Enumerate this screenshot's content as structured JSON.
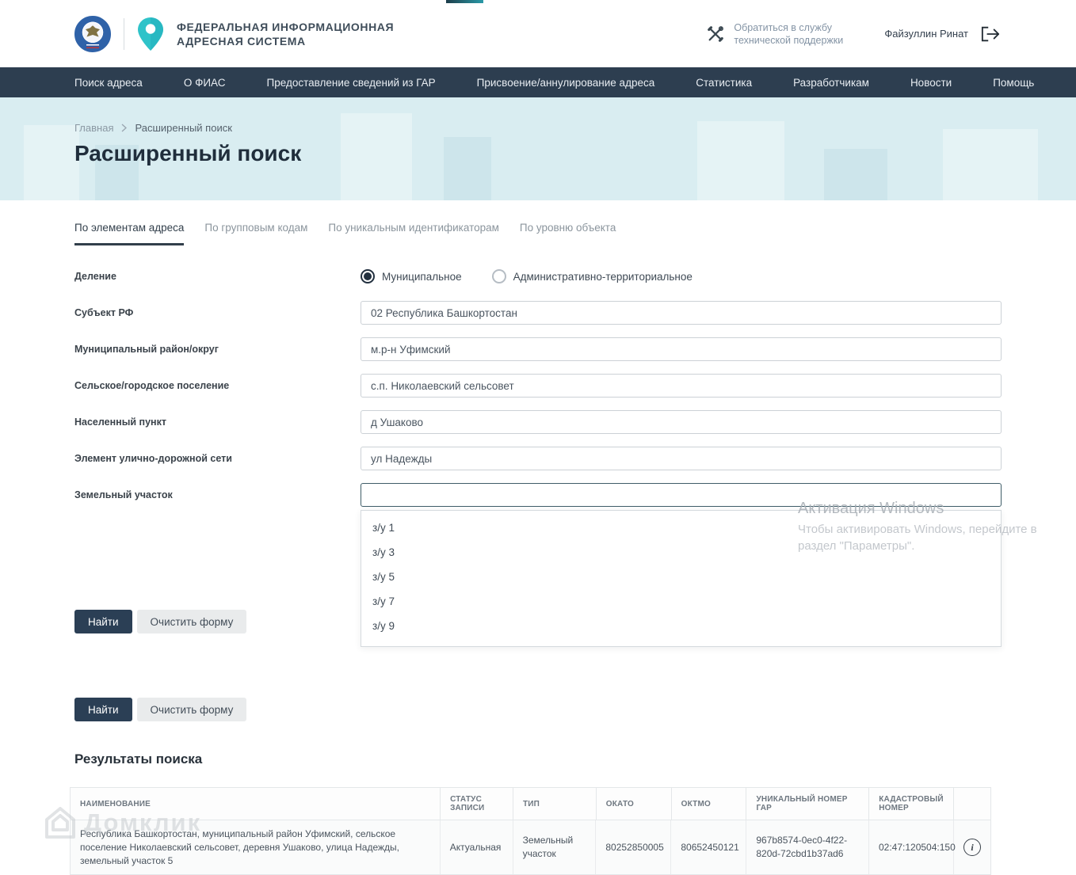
{
  "header": {
    "title_line1": "ФЕДЕРАЛЬНАЯ ИНФОРМАЦИОННАЯ",
    "title_line2": "АДРЕСНАЯ СИСТЕМА",
    "support_link": "Обратиться в службу технической поддержки",
    "user_name": "Файзуллин Ринат"
  },
  "nav": {
    "items": [
      "Поиск адреса",
      "О ФИАС",
      "Предоставление сведений из ГАР",
      "Присвоение/аннулирование адреса",
      "Статистика",
      "Разработчикам",
      "Новости",
      "Помощь"
    ]
  },
  "breadcrumb": {
    "home": "Главная",
    "current": "Расширенный поиск"
  },
  "page": {
    "title": "Расширенный поиск"
  },
  "tabs": [
    "По элементам адреса",
    "По групповым кодам",
    "По уникальным идентификаторам",
    "По уровню объекта"
  ],
  "form": {
    "division_label": "Деление",
    "division_options": [
      "Муниципальное",
      "Административно-территориальное"
    ],
    "selected_division": "Муниципальное",
    "fields": [
      {
        "label": "Субъект РФ",
        "value": "02 Республика Башкортостан"
      },
      {
        "label": "Муниципальный район/округ",
        "value": "м.р-н Уфимский"
      },
      {
        "label": "Сельское/городское поселение",
        "value": "с.п. Николаевский сельсовет"
      },
      {
        "label": "Населенный пункт",
        "value": "д Ушаково"
      },
      {
        "label": "Элемент улично-дорожной сети",
        "value": "ул Надежды"
      },
      {
        "label": "Земельный участок",
        "value": ""
      }
    ],
    "dropdown_options": [
      "з/у 1",
      "з/у 3",
      "з/у 5",
      "з/у 7",
      "з/у 9"
    ],
    "search_button": "Найти",
    "clear_button": "Очистить форму"
  },
  "results": {
    "title": "Результаты поиска",
    "columns": [
      "НАИМЕНОВАНИЕ",
      "СТАТУС ЗАПИСИ",
      "ТИП",
      "ОКАТО",
      "ОКТМО",
      "УНИКАЛЬНЫЙ НОМЕР ГАР",
      "КАДАСТРОВЫЙ НОМЕР"
    ],
    "rows": [
      {
        "name": "Республика Башкортостан, муниципальный район Уфимский, сельское поселение Николаевский сельсовет, деревня Ушаково, улица Надежды, земельный участок 5",
        "status": "Актуальная",
        "type": "Земельный участок",
        "okato": "80252850005",
        "oktmo": "80652450121",
        "gar_number": "967b8574-0ec0-4f22-820d-72cbd1b37ad6",
        "cadastral_number": "02:47:120504:150"
      }
    ]
  },
  "watermarks": {
    "windows_title": "Активация Windows",
    "windows_line1": "Чтобы активировать Windows, перейдите в",
    "windows_line2": "раздел \"Параметры\".",
    "domclick": "Домклик"
  },
  "colors": {
    "nav_bg": "#2d3e50",
    "hero_bg": "#d9edf1",
    "accent_teal": "#2fc3c9",
    "primary_button": "#2b3f55",
    "active_radio": "#22303f",
    "focused_input_border": "#3f5d68"
  }
}
